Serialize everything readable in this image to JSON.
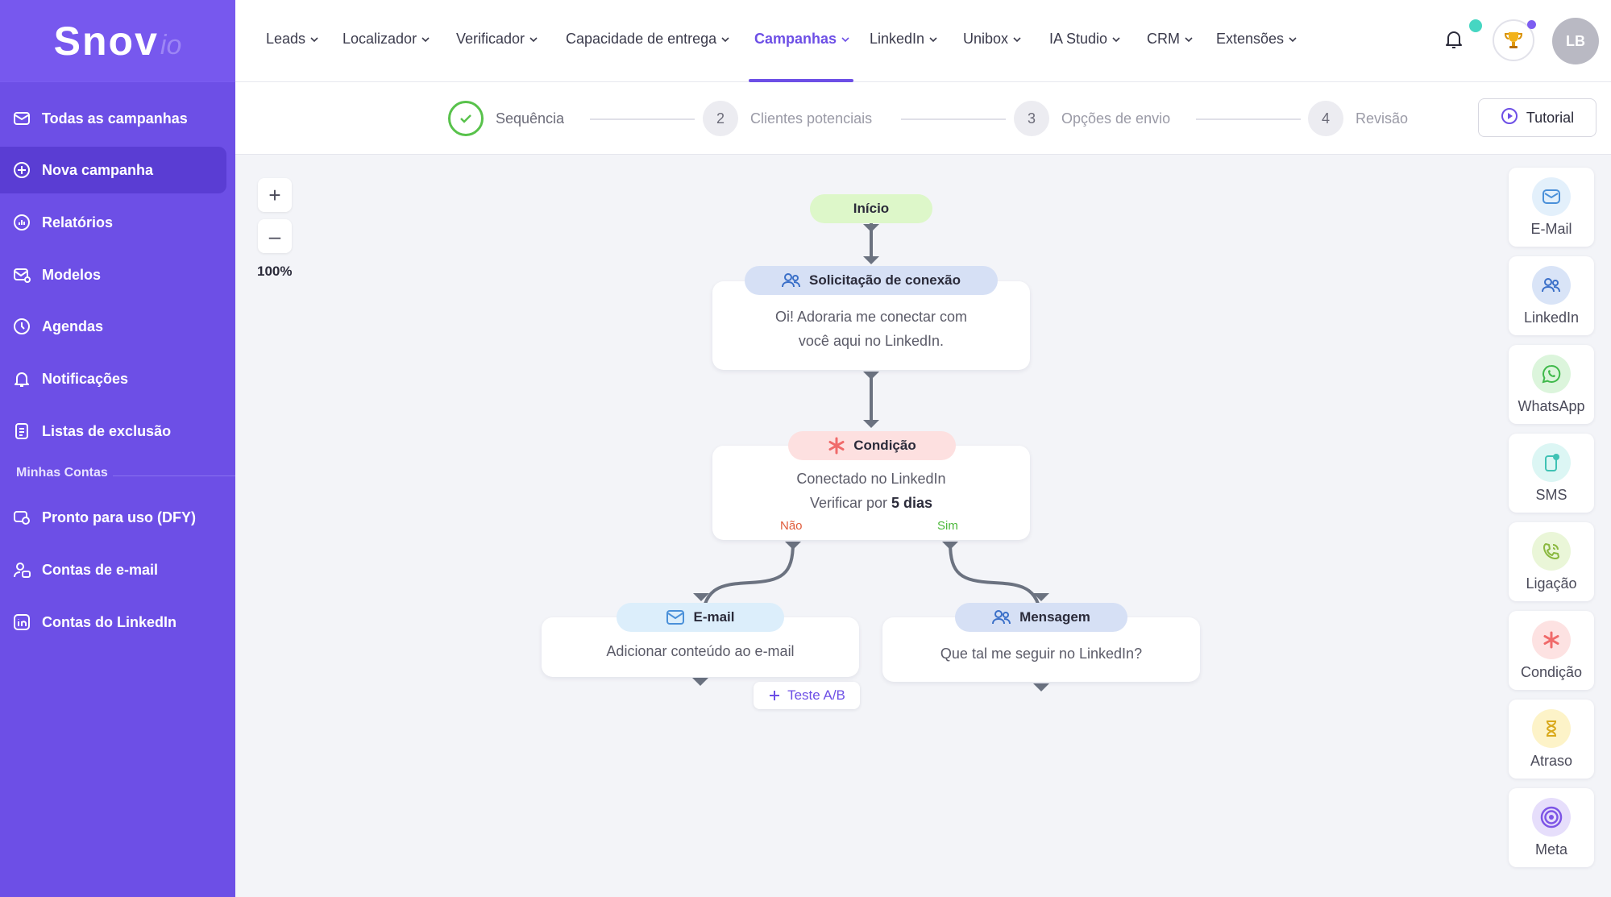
{
  "logo": {
    "main": "Snov",
    "sub": "io"
  },
  "sidebar": {
    "items": [
      {
        "label": "Todas as campanhas",
        "icon": "envelope-icon"
      },
      {
        "label": "Nova campanha",
        "icon": "plus-circle-icon",
        "active": true
      },
      {
        "label": "Relatórios",
        "icon": "chart-circle-icon"
      },
      {
        "label": "Modelos",
        "icon": "envelope-template-icon"
      },
      {
        "label": "Agendas",
        "icon": "clock-icon"
      },
      {
        "label": "Notificações",
        "icon": "bell-icon"
      },
      {
        "label": "Listas de exclusão",
        "icon": "document-list-icon"
      }
    ],
    "section_title": "Minhas Contas",
    "account_items": [
      {
        "label": "Pronto para uso (DFY)",
        "icon": "dfy-icon"
      },
      {
        "label": "Contas de e-mail",
        "icon": "user-mail-icon"
      },
      {
        "label": "Contas do LinkedIn",
        "icon": "linkedin-icon"
      }
    ]
  },
  "topnav": {
    "items": [
      "Leads",
      "Localizador",
      "Verificador",
      "Capacidade de entrega",
      "Campanhas",
      "LinkedIn",
      "Unibox",
      "IA Studio",
      "CRM",
      "Extensões"
    ],
    "active": "Campanhas",
    "avatar_initials": "LB"
  },
  "stepper": {
    "steps": [
      {
        "number": "",
        "label": "Sequência",
        "done": true
      },
      {
        "number": "2",
        "label": "Clientes potenciais"
      },
      {
        "number": "3",
        "label": "Opções de envio"
      },
      {
        "number": "4",
        "label": "Revisão"
      }
    ],
    "tutorial_label": "Tutorial"
  },
  "zoom": {
    "plus": "+",
    "minus": "–",
    "level": "100%"
  },
  "flow": {
    "start_label": "Início",
    "connection": {
      "title": "Solicitação de conexão",
      "line1": "Oi! Adoraria me conectar com",
      "line2": "você aqui no LinkedIn."
    },
    "condition": {
      "title": "Condição",
      "line1": "Conectado no LinkedIn",
      "line2_prefix": "Verificar por ",
      "line2_bold": "5 dias",
      "no_label": "Não",
      "yes_label": "Sim"
    },
    "email": {
      "title": "E-mail",
      "body": "Adicionar conteúdo ao e-mail",
      "ab_label": "Teste A/B"
    },
    "message": {
      "title": "Mensagem",
      "body": "Que tal me seguir no LinkedIn?"
    }
  },
  "toolbox": [
    {
      "label": "E-Mail",
      "icon": "envelope-icon",
      "bg": "#e3f0fb",
      "fg": "#4a90d9"
    },
    {
      "label": "LinkedIn",
      "icon": "people-icon",
      "bg": "#d9e4f7",
      "fg": "#3a6fc8"
    },
    {
      "label": "WhatsApp",
      "icon": "whatsapp-icon",
      "bg": "#dcf5dc",
      "fg": "#3fb94a"
    },
    {
      "label": "SMS",
      "icon": "sms-icon",
      "bg": "#dcf6f4",
      "fg": "#3fc2b4"
    },
    {
      "label": "Ligação",
      "icon": "phone-icon",
      "bg": "#eaf6d8",
      "fg": "#8ab83f"
    },
    {
      "label": "Condição",
      "icon": "asterisk-icon",
      "bg": "#fde2e2",
      "fg": "#f06a6a"
    },
    {
      "label": "Atraso",
      "icon": "hourglass-icon",
      "bg": "#fdf3c8",
      "fg": "#d9a91b"
    },
    {
      "label": "Meta",
      "icon": "target-icon",
      "bg": "#e6defb",
      "fg": "#7d55e6"
    }
  ]
}
